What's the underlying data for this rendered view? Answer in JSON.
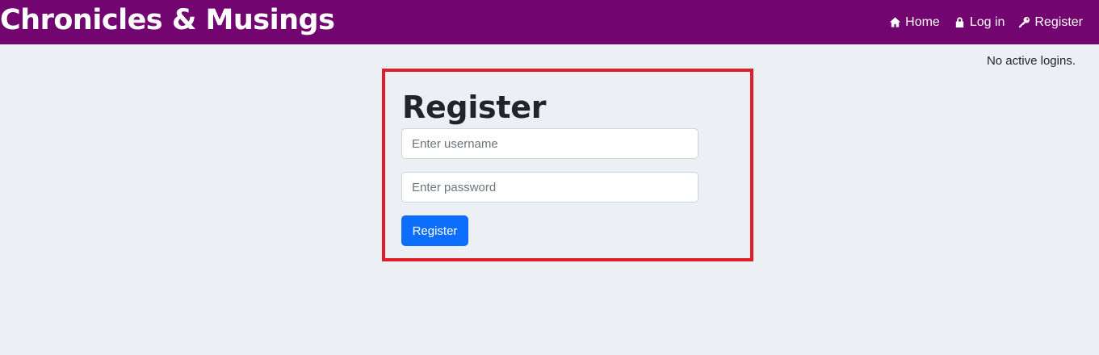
{
  "header": {
    "brand": "Chronicles & Musings",
    "nav": [
      {
        "label": "Home",
        "icon": "home-icon"
      },
      {
        "label": "Log in",
        "icon": "lock-icon"
      },
      {
        "label": "Register",
        "icon": "key-icon"
      }
    ],
    "background_color": "#720570"
  },
  "status": {
    "text": "No active logins."
  },
  "register_form": {
    "title": "Register",
    "username_placeholder": "Enter username",
    "username_value": "",
    "password_placeholder": "Enter password",
    "password_value": "",
    "submit_label": "Register",
    "highlight_color": "#e11d2a",
    "button_color": "#0d6efd"
  }
}
